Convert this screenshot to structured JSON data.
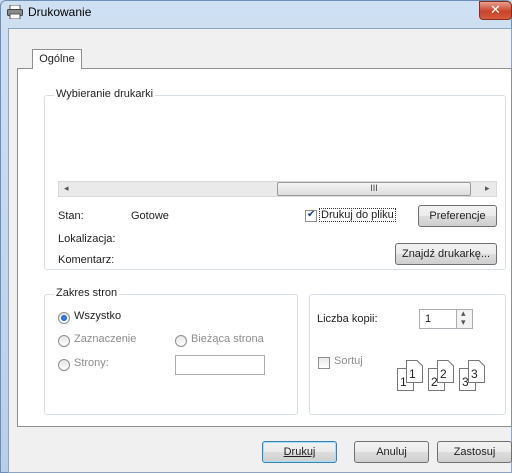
{
  "window": {
    "title": "Drukowanie",
    "close_glyph": "✕"
  },
  "tabs": [
    {
      "label": "Ogólne"
    }
  ],
  "printer_group": {
    "legend": "Wybieranie drukarki",
    "scroll_thumb_glyph": "III",
    "scroll_left_glyph": "◂",
    "scroll_right_glyph": "▸"
  },
  "status": {
    "stan_label": "Stan:",
    "stan_value": "Gotowe",
    "lokalizacja_label": "Lokalizacja:",
    "komentarz_label": "Komentarz:"
  },
  "print_to_file": {
    "label": "Drukuj do pliku",
    "checked": true
  },
  "buttons": {
    "preferences": "Preferencje",
    "find_printer": "Znajdź drukarkę...",
    "print": "Drukuj",
    "cancel": "Anuluj",
    "apply": "Zastosuj"
  },
  "page_range": {
    "legend": "Zakres stron",
    "all": "Wszystko",
    "selection": "Zaznaczenie",
    "current_page": "Bieżąca strona",
    "pages": "Strony:",
    "selected": "all",
    "pages_value": ""
  },
  "copies": {
    "label": "Liczba kopii:",
    "value": "1",
    "collate_label": "Sortuj",
    "collate_checked": false,
    "spin_up": "▴",
    "spin_down": "▾",
    "collate_pages": [
      "1",
      "1",
      "2",
      "2",
      "3",
      "3"
    ]
  },
  "icons": {
    "title_icon": "printer-icon",
    "check": "✔"
  }
}
